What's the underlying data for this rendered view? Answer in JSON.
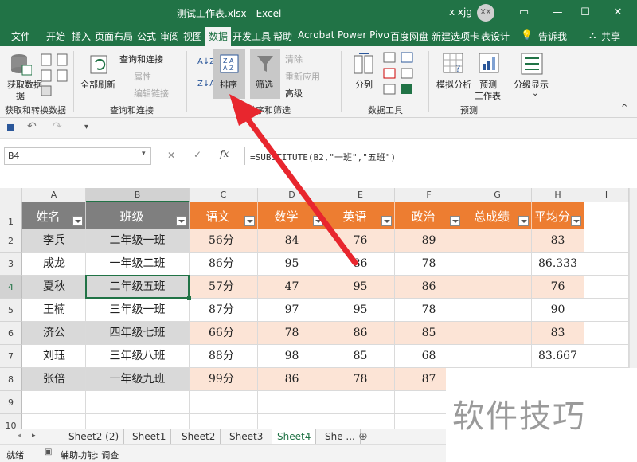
{
  "window": {
    "title": "测试工作表.xlsx  -  Excel",
    "user": "x xjg",
    "avatar": "XX",
    "minimize": "—",
    "restore": "❐",
    "maximize": "☐",
    "close": "✕"
  },
  "ribbon_tabs": [
    "文件",
    "开始",
    "插入",
    "页面布局",
    "公式",
    "审阅",
    "视图",
    "数据",
    "开发工具",
    "帮助",
    "Acrobat",
    "Power Pivo",
    "百度网盘",
    "新建选项卡",
    "表设计"
  ],
  "active_tab": "数据",
  "tell_me": "告诉我",
  "share": "共享",
  "ribbon": {
    "get_data": "获取数据",
    "get_data_2": "据",
    "group_get": "获取和转换数据",
    "refresh_all": "全部刷新",
    "queries_connections": "查询和连接",
    "properties": "属性",
    "edit_links": "编辑链接",
    "group_queries": "查询和连接",
    "sort_az": "A↓Z",
    "sort_za": "Z↓A",
    "sort": "排序",
    "filter": "筛选",
    "clear": "清除",
    "reapply": "重新应用",
    "advanced": "高级",
    "group_sort": "排序和筛选",
    "text_to_columns": "分列",
    "group_tools": "数据工具",
    "what_if": "模拟分析",
    "forecast_sheet": "预测",
    "forecast_sheet_2": "工作表",
    "group_forecast": "预测",
    "outline": "分级显示"
  },
  "qat": {
    "save": "💾",
    "undo": "↶",
    "redo": "↷",
    "more": "▾"
  },
  "formula_bar": {
    "name_box": "B4",
    "cancel": "✕",
    "enter": "✓",
    "fx": "fx",
    "formula": "=SUBSTITUTE(B2,\"一班\",\"五班\")"
  },
  "columns": [
    "A",
    "B",
    "C",
    "D",
    "E",
    "F",
    "G",
    "H",
    "I"
  ],
  "rows": [
    "1",
    "2",
    "3",
    "4",
    "5",
    "6",
    "7",
    "8",
    "9",
    "10"
  ],
  "table": {
    "headers": [
      "姓名",
      "班级",
      "语文",
      "数学",
      "英语",
      "政治",
      "总成绩",
      "平均分"
    ],
    "rows": [
      [
        "李兵",
        "二年级一班",
        "56分",
        "84",
        "76",
        "89",
        "",
        "83"
      ],
      [
        "成龙",
        "一年级二班",
        "86分",
        "95",
        "86",
        "78",
        "",
        "86.333"
      ],
      [
        "夏秋",
        "二年级五班",
        "57分",
        "47",
        "95",
        "86",
        "",
        "76"
      ],
      [
        "王楠",
        "三年级一班",
        "87分",
        "97",
        "95",
        "78",
        "",
        "90"
      ],
      [
        "济公",
        "四年级七班",
        "66分",
        "78",
        "86",
        "85",
        "",
        "83"
      ],
      [
        "刘珏",
        "三年级八班",
        "88分",
        "98",
        "85",
        "68",
        "",
        "83.667"
      ],
      [
        "张倍",
        "一年级九班",
        "99分",
        "86",
        "78",
        "87",
        "",
        ""
      ]
    ]
  },
  "sheet_tabs": [
    "Sheet2 (2)",
    "Sheet1",
    "Sheet2",
    "Sheet3",
    "Sheet4",
    "She ..."
  ],
  "active_sheet": "Sheet4",
  "add_sheet": "⊕",
  "status": {
    "ready": "就绪",
    "accessibility": "辅助功能: 调查"
  },
  "watermark": "软件技巧",
  "colors": {
    "excel_green": "#217346",
    "header_gray": "#7f7f7f",
    "header_orange": "#ed7d31",
    "band_light_orange": "#fce4d6",
    "band_gray": "#d9d9d9",
    "arrow_red": "#e8262e"
  }
}
